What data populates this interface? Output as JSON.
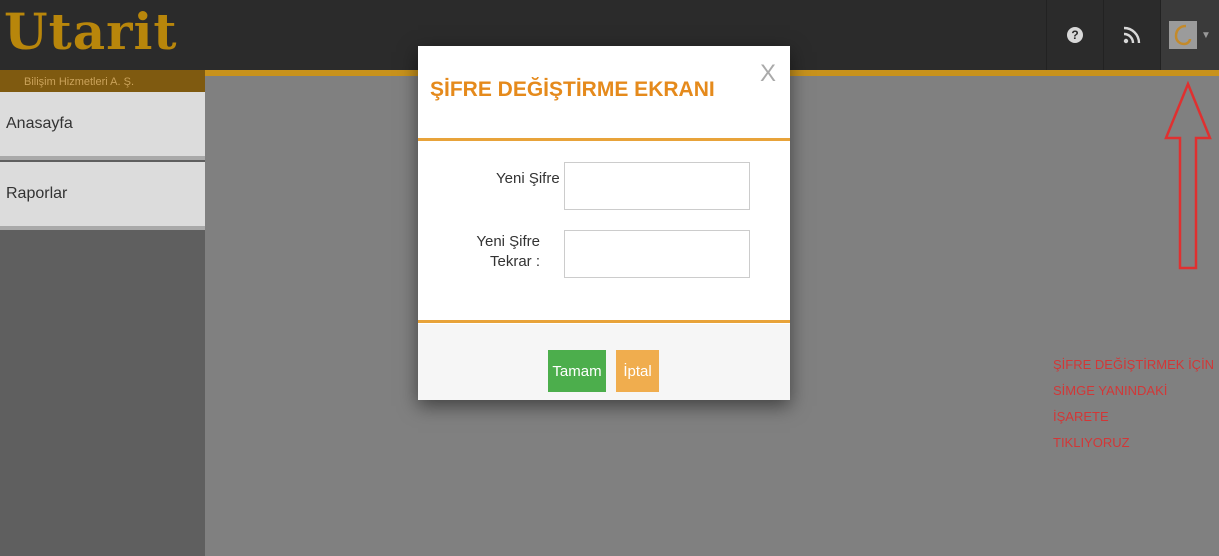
{
  "header": {
    "logo": "Utarit",
    "logo_subtitle": "Bilişim Hizmetleri A. Ş.",
    "icons": [
      "help-icon",
      "rss-icon",
      "user-avatar-icon",
      "caret-down-icon"
    ]
  },
  "sidebar": {
    "items": [
      {
        "label": "Anasayfa"
      },
      {
        "label": "Raporlar"
      }
    ]
  },
  "modal": {
    "title": "ŞİFRE DEĞİŞTİRME EKRANI",
    "close": "X",
    "fields": [
      {
        "label": "Yeni Şifre :",
        "value": ""
      },
      {
        "label_line1": "Yeni Şifre",
        "label_line2": "Tekrar :",
        "value": ""
      }
    ],
    "buttons": {
      "ok": "Tamam",
      "cancel": "İptal"
    }
  },
  "annotation": {
    "lines": [
      "ŞİFRE DEĞİŞTİRMEK İÇİN",
      "SİMGE YANINDAKİ İŞARETE",
      "TIKLIYORUZ"
    ]
  },
  "colors": {
    "accent": "#e58a1c",
    "header_bg": "#2b2b2b",
    "annotation_red": "#d23737",
    "ok_green": "#4cae4c",
    "cancel_orange": "#f0ad4e"
  }
}
